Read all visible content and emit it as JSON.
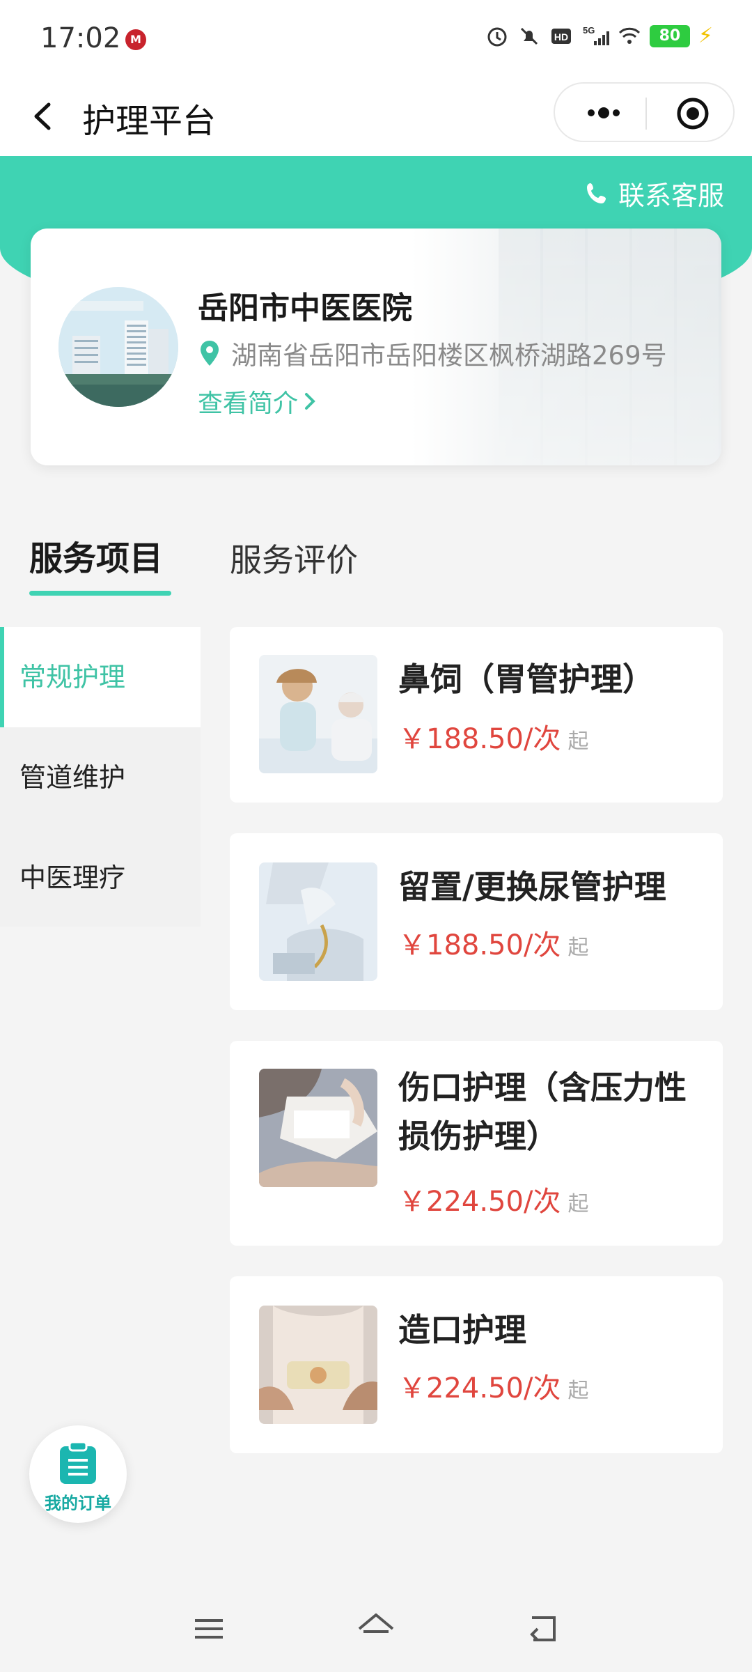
{
  "status_bar": {
    "time": "17:02",
    "battery": "80",
    "icons": [
      "app-icon",
      "alarm-icon",
      "mute-icon",
      "hd-icon",
      "5g-signal-icon",
      "wifi-icon",
      "battery-icon",
      "charging-icon"
    ]
  },
  "nav": {
    "title": "护理平台",
    "back_icon": "chevron-left-icon",
    "more_icon": "more-dots-icon",
    "close_icon": "target-icon"
  },
  "header": {
    "contact_label": "联系客服",
    "contact_icon": "phone-icon",
    "accent_color": "#3fd3b3"
  },
  "hospital": {
    "name": "岳阳市中医医院",
    "address": "湖南省岳阳市岳阳楼区枫桥湖路269号",
    "intro_link": "查看简介"
  },
  "tabs": [
    {
      "label": "服务项目",
      "active": true
    },
    {
      "label": "服务评价",
      "active": false
    }
  ],
  "sidebar": {
    "items": [
      {
        "label": "常规护理",
        "active": true
      },
      {
        "label": "管道维护",
        "active": false
      },
      {
        "label": "中医理疗",
        "active": false
      }
    ]
  },
  "services": [
    {
      "name": "鼻饲（胃管护理）",
      "price": "￥188.50/次",
      "from": "起"
    },
    {
      "name": "留置/更换尿管护理",
      "price": "￥188.50/次",
      "from": "起"
    },
    {
      "name": "伤口护理（含压力性损伤护理）",
      "price": "￥224.50/次",
      "from": "起"
    },
    {
      "name": "造口护理",
      "price": "￥224.50/次",
      "from": "起"
    }
  ],
  "order_button": {
    "label": "我的订单"
  },
  "bottom_nav": {
    "icons": [
      "menu-icon",
      "home-icon",
      "back-icon"
    ]
  }
}
